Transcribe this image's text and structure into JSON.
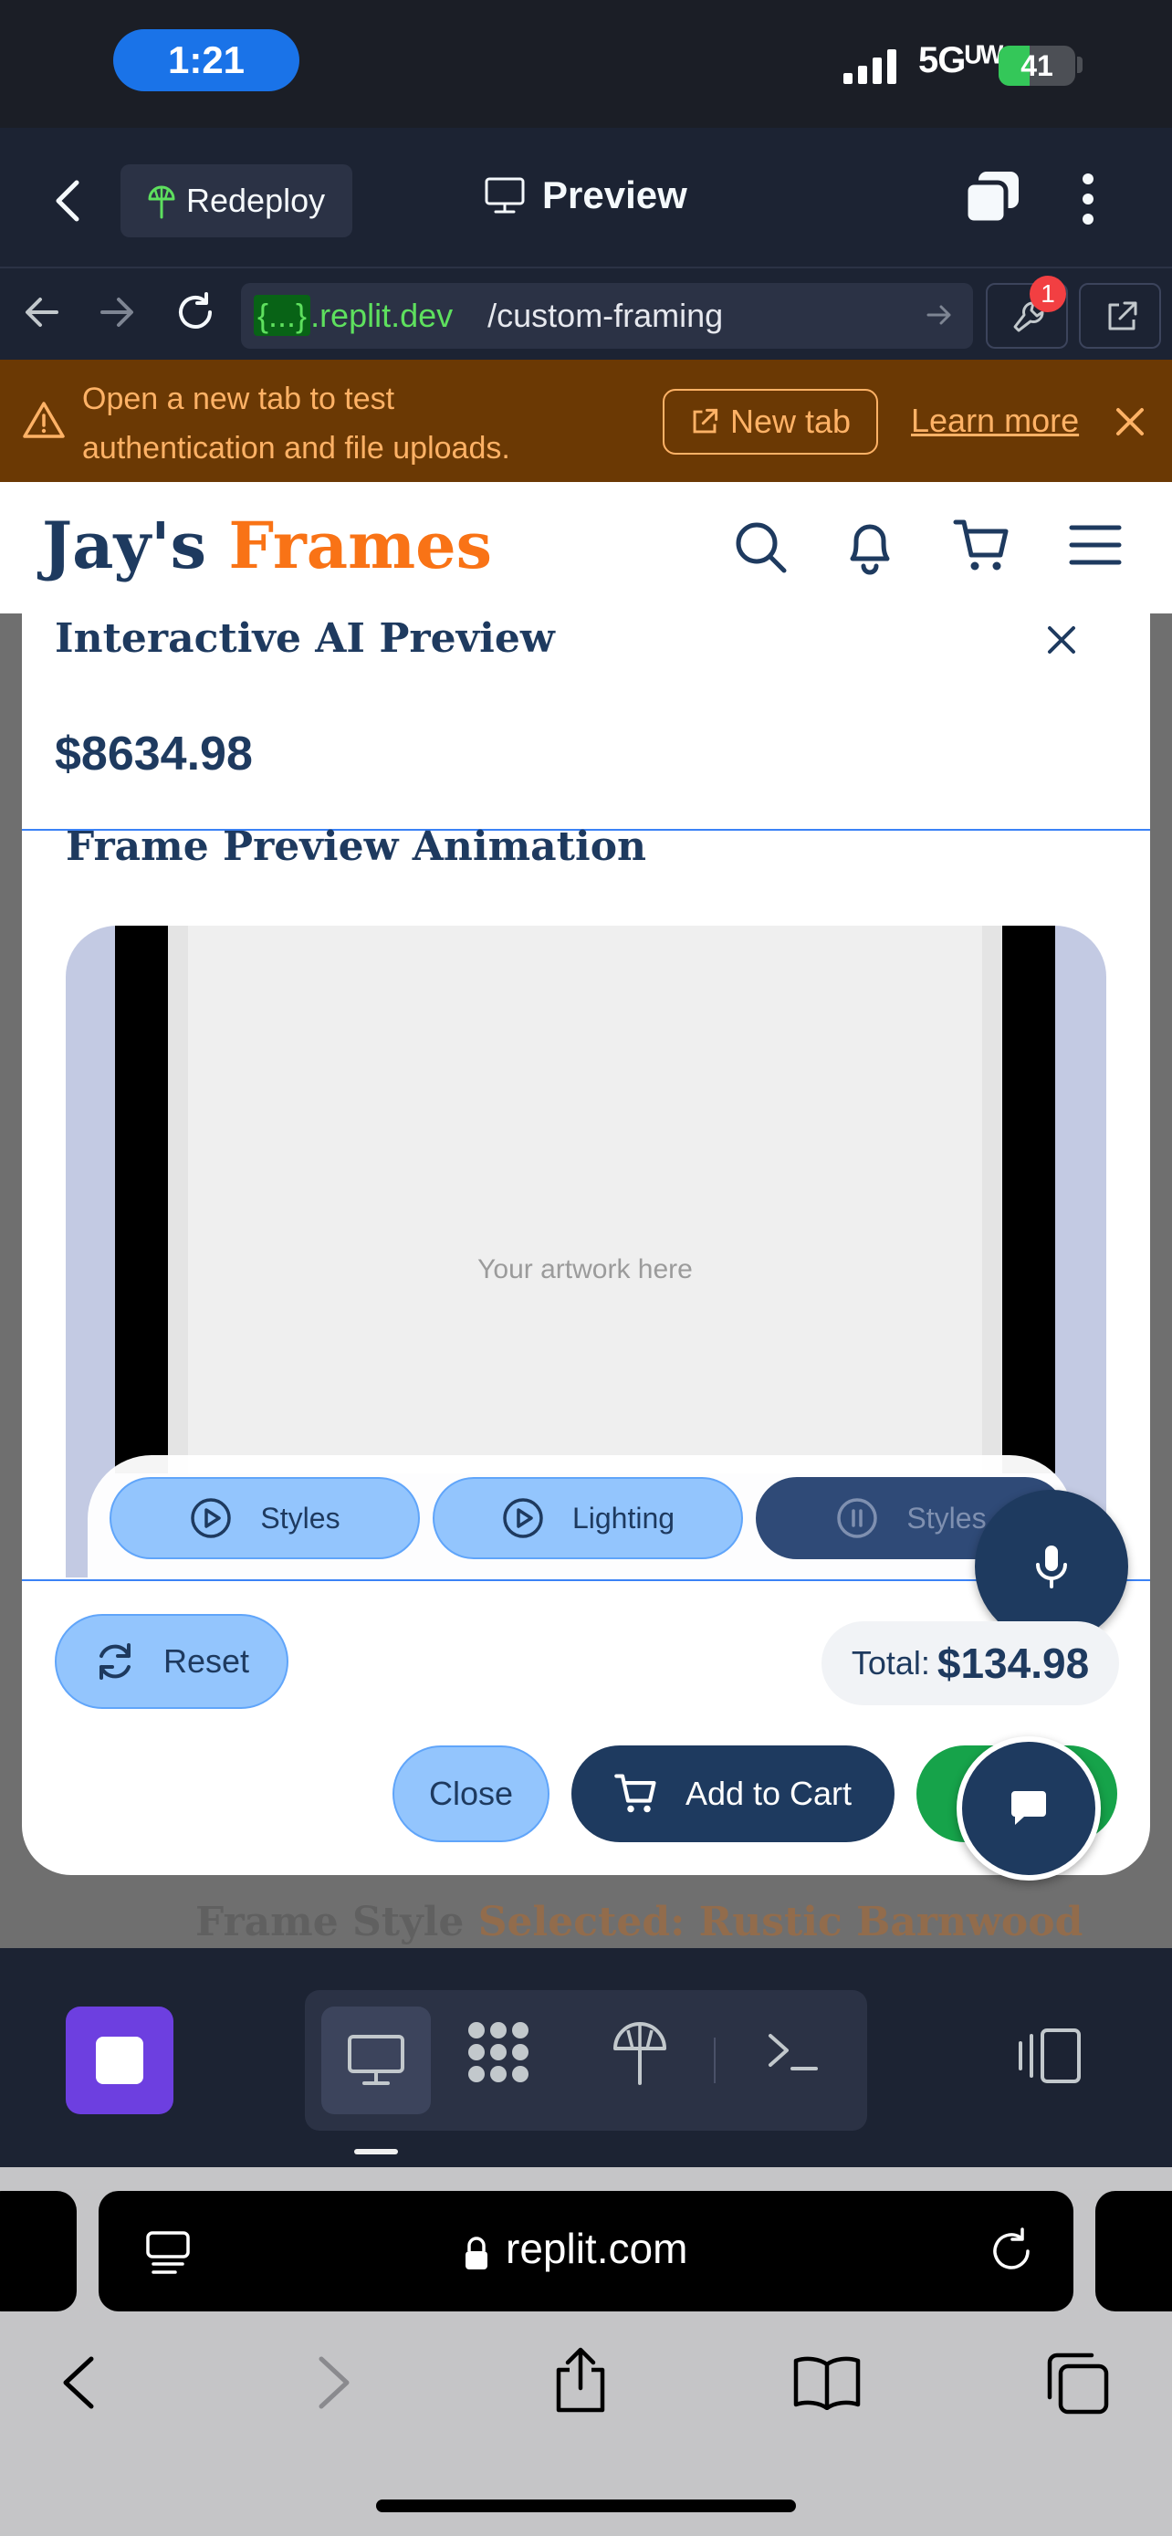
{
  "status_bar": {
    "time": "1:21",
    "network": "5Gᵁᵂ",
    "battery": "41",
    "battery_level": 0.41,
    "battery_color": "#34c759"
  },
  "replit_header": {
    "redeploy_label": "Redeploy",
    "preview_title": "Preview"
  },
  "url_bar": {
    "host_brace": "{...}",
    "host_domain": ".replit.dev",
    "path": "/custom-framing",
    "devtools_badge": "1"
  },
  "banner": {
    "message_line1": "Open a new tab to test",
    "message_line2": "authentication and file uploads.",
    "new_tab_label": "New tab",
    "learn_more_label": "Learn more",
    "bg_color": "#6b3904",
    "text_color": "#ffb266"
  },
  "site": {
    "logo_part1": "Jay's",
    "logo_part2": "Frames",
    "primary_color": "#1e3a5f",
    "accent_color": "#f97316"
  },
  "backdrop": {
    "partial_label": "Frame Style",
    "partial_value": "Selected: Rustic Barnwood"
  },
  "modal": {
    "title": "Interactive AI Preview",
    "price": "$8634.98",
    "section_title": "Frame Preview Animation",
    "artwork_placeholder": "Your artwork here",
    "controls": [
      {
        "label": "Styles",
        "icon": "play-circle-icon",
        "state": "idle"
      },
      {
        "label": "Lighting",
        "icon": "play-circle-icon",
        "state": "idle"
      },
      {
        "label": "Styles",
        "icon": "pause-circle-icon",
        "state": "active"
      }
    ],
    "reset_label": "Reset",
    "total_label": "Total:",
    "total_value": "$134.98",
    "close_label": "Close",
    "add_to_cart_label": "Add to Cart"
  },
  "bottom_toolbar": {
    "tools": [
      "preview-icon",
      "apps-icon",
      "deployments-icon",
      "shell-icon"
    ],
    "active_tool": "preview-icon",
    "app_color": "#6d3fe0"
  },
  "safari": {
    "host": "replit.com"
  }
}
